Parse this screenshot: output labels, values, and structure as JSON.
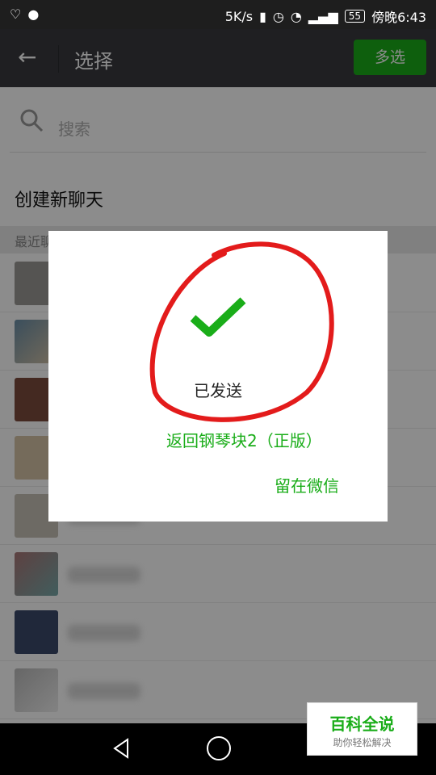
{
  "status_bar": {
    "speed": "5K/s",
    "battery": "55",
    "time": "傍晚6:43"
  },
  "app_bar": {
    "title": "选择",
    "multi_select": "多选"
  },
  "search": {
    "placeholder": "搜索"
  },
  "create_new_chat": "创建新聊天",
  "section_label": "最近聊天",
  "dialog": {
    "message": "已发送",
    "back_button": "返回钢琴块2（正版）",
    "stay_button": "留在微信"
  },
  "watermark": {
    "title": "百科全说",
    "subtitle": "助你轻松解决"
  },
  "colors": {
    "accent_green": "#1aad19",
    "app_bar": "#393a3f",
    "red_annotation": "#e31b1b"
  }
}
